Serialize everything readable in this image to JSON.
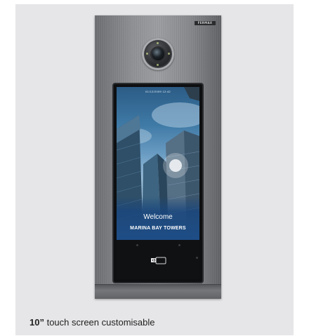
{
  "device": {
    "brand_label": "FERMAX",
    "screen": {
      "datetime": "01/12/2009  12:42",
      "welcome_text": "Welcome",
      "building_name": "MARINA BAY TOWERS"
    },
    "card_reader_icon": "contactless-card-icon"
  },
  "caption": {
    "size": "10”",
    "text": " touch screen customisable"
  },
  "colors": {
    "background_frame": "#e6e6e8",
    "panel": "#8d8f93",
    "screen_sky": "#3f7aa6",
    "welcome_band": "#1e4d86"
  }
}
